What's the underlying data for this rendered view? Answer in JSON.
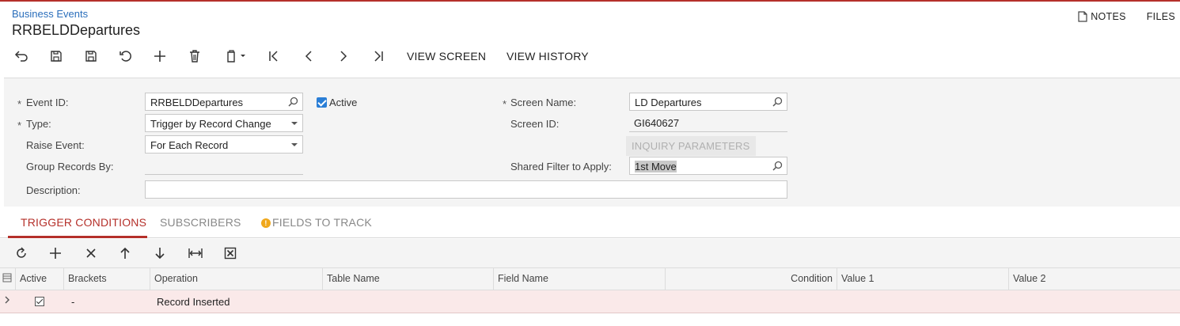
{
  "header": {
    "breadcrumb": "Business Events",
    "title": "RRBELDDepartures",
    "notes_label": "NOTES",
    "files_label": "FILES"
  },
  "toolbar": {
    "icons": [
      "undo-icon",
      "save-close-icon",
      "save-icon",
      "cancel-icon",
      "add-icon",
      "delete-icon",
      "copy-paste-icon",
      "first-icon",
      "previous-icon",
      "next-icon",
      "last-icon"
    ],
    "view_screen_label": "VIEW SCREEN",
    "view_history_label": "VIEW HISTORY"
  },
  "form": {
    "event_id_label": "Event ID:",
    "event_id_value": "RRBELDDepartures",
    "active_label": "Active",
    "active_checked": true,
    "type_label": "Type:",
    "type_value": "Trigger by Record Change",
    "raise_event_label": "Raise Event:",
    "raise_event_value": "For Each Record",
    "group_records_label": "Group Records By:",
    "group_records_value": "",
    "description_label": "Description:",
    "description_value": "",
    "screen_name_label": "Screen Name:",
    "screen_name_value": "LD Departures",
    "screen_id_label": "Screen ID:",
    "screen_id_value": "GI640627",
    "inquiry_parameters_label": "INQUIRY PARAMETERS",
    "shared_filter_label": "Shared Filter to Apply:",
    "shared_filter_value": "1st Move",
    "required_marker": "*"
  },
  "tabs": [
    {
      "label": "TRIGGER CONDITIONS",
      "active": true
    },
    {
      "label": "SUBSCRIBERS",
      "active": false
    },
    {
      "label": "FIELDS TO TRACK",
      "active": false,
      "warning": "!"
    }
  ],
  "grid": {
    "toolbar_icons": [
      "refresh-icon",
      "add-row-icon",
      "delete-row-icon",
      "move-up-icon",
      "move-down-icon",
      "fit-columns-icon",
      "export-excel-icon"
    ],
    "columns": [
      "Active",
      "Brackets",
      "Operation",
      "Table Name",
      "Field Name",
      "Condition",
      "Value 1",
      "Value 2"
    ],
    "rows": [
      {
        "active": true,
        "brackets": "-",
        "operation": "Record Inserted",
        "table_name": "",
        "field_name": "",
        "condition": "",
        "value1": "",
        "value2": ""
      }
    ]
  },
  "colors": {
    "accent": "#b5302a",
    "link": "#2a6ebb",
    "checkbox": "#2a7ed6",
    "selected_row": "#fae9e9"
  }
}
